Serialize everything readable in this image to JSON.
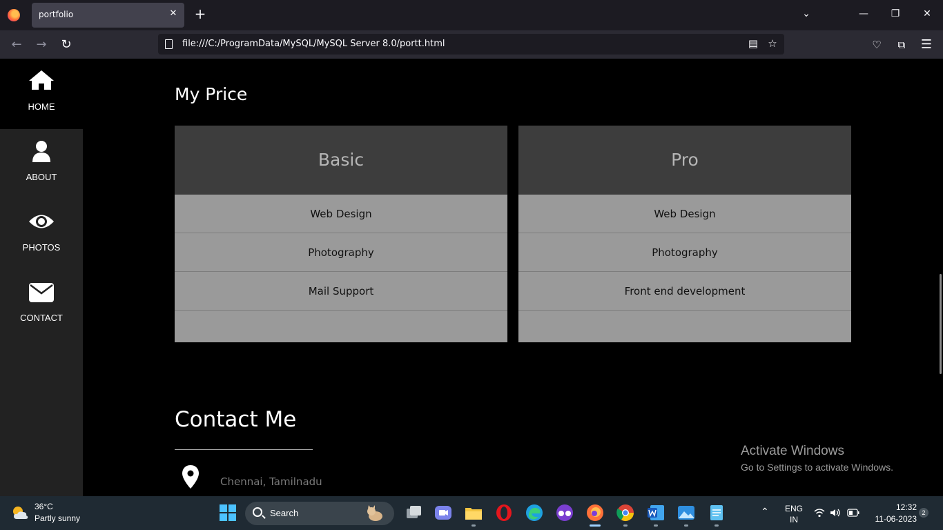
{
  "browser": {
    "tab_title": "portfolio",
    "tab_close": "✕",
    "new_tab": "+",
    "url": "file:///C:/ProgramData/MySQL/MySQL Server 8.0/portt.html",
    "window_controls": {
      "list": "⌄",
      "minimize": "—",
      "restore": "❐",
      "close": "✕"
    }
  },
  "sidebar": {
    "items": [
      {
        "label": "HOME",
        "icon": "home-icon",
        "active": true
      },
      {
        "label": "ABOUT",
        "icon": "user-icon"
      },
      {
        "label": "PHOTOS",
        "icon": "eye-icon"
      },
      {
        "label": "CONTACT",
        "icon": "envelope-icon"
      }
    ]
  },
  "pricing": {
    "title": "My Price",
    "plans": [
      {
        "name": "Basic",
        "features": [
          "Web Design",
          "Photography",
          "Mail Support",
          ""
        ]
      },
      {
        "name": "Pro",
        "features": [
          "Web Design",
          "Photography",
          "Front end development",
          ""
        ]
      }
    ]
  },
  "contact": {
    "title": "Contact Me",
    "location": "Chennai, Tamilnadu"
  },
  "watermark": {
    "title": "Activate Windows",
    "subtitle": "Go to Settings to activate Windows."
  },
  "taskbar": {
    "weather_temp": "36°C",
    "weather_desc": "Partly sunny",
    "search_label": "Search",
    "lang_top": "ENG",
    "lang_bottom": "IN",
    "time": "12:32",
    "date": "11-06-2023",
    "notification_count": "2"
  },
  "colors": {
    "sidebar_bg": "#222222",
    "card_head_bg": "#3d3d3d",
    "card_body_bg": "#9a9a9a",
    "taskbar_bg": "#1f2a33"
  }
}
